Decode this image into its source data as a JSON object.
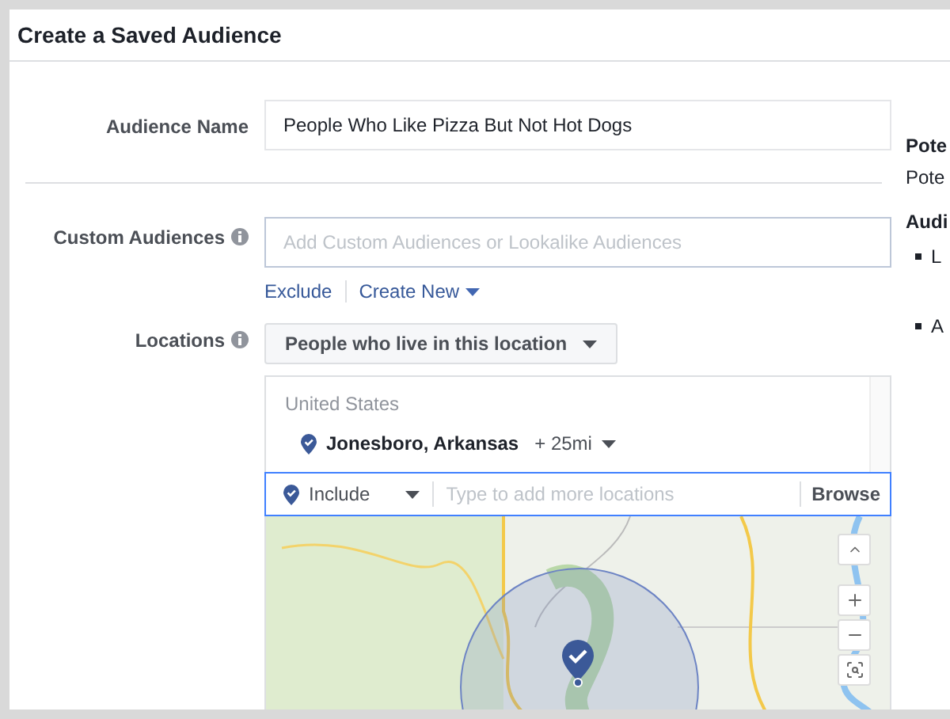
{
  "dialog": {
    "title": "Create a Saved Audience"
  },
  "audience_name": {
    "label": "Audience Name",
    "value": "People Who Like Pizza But Not Hot Dogs"
  },
  "custom_audiences": {
    "label": "Custom Audiences",
    "placeholder": "Add Custom Audiences or Lookalike Audiences",
    "links": [
      {
        "label": "Exclude",
        "kind": "link"
      },
      {
        "label": "Create New",
        "kind": "dropdown"
      }
    ]
  },
  "locations": {
    "label": "Locations",
    "dropdown": "People who live in this location",
    "country": "United States",
    "items": [
      {
        "name": "Jonesboro, Arkansas",
        "radius": "+ 25mi"
      }
    ],
    "include": {
      "label": "Include",
      "placeholder": "Type to add more locations",
      "browse": "Browse"
    }
  },
  "side_panel": {
    "heading": "Pote",
    "text": "Pote",
    "subheading": "Audi",
    "bullets": [
      "L",
      "A"
    ]
  }
}
